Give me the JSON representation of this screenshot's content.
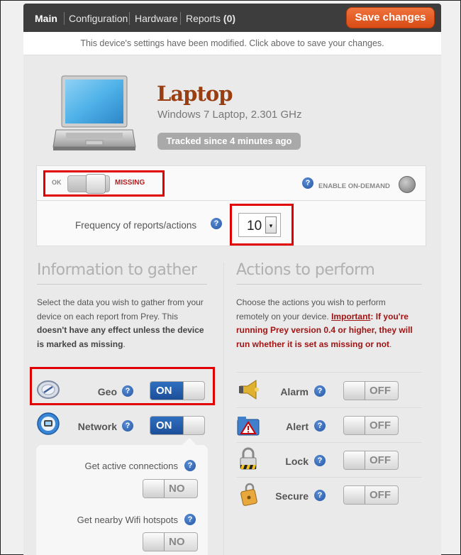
{
  "nav": {
    "tabs": [
      {
        "label": "Main"
      },
      {
        "label": "Configuration"
      },
      {
        "label": "Hardware"
      },
      {
        "label": "Reports"
      }
    ],
    "reports_count": "(0)",
    "save_label": "Save changes"
  },
  "notice": "This device's settings have been modified. Click above to save your changes.",
  "device": {
    "name": "Laptop",
    "subtitle": "Windows 7 Laptop, 2.301 GHz",
    "tracked": "Tracked since 4 minutes ago"
  },
  "status": {
    "ok_label": "OK",
    "missing_label": "MISSING",
    "ondemand_label": "ENABLE ON-DEMAND",
    "frequency_label": "Frequency of reports/actions",
    "frequency_value": "10"
  },
  "info": {
    "title": "Information to gather",
    "text_1": "Select the data you wish to gather from your",
    "text_2": "device on each report from Prey. This",
    "text_3": "doesn't have any effect unless the device",
    "text_4": "is marked as missing",
    "text_4_end": ".",
    "items": [
      {
        "label": "Geo",
        "state": "ON"
      },
      {
        "label": "Network",
        "state": "ON"
      }
    ],
    "sub_items": [
      {
        "label": "Get active connections",
        "state": "NO"
      },
      {
        "label": "Get nearby Wifi hotspots",
        "state": "NO"
      }
    ]
  },
  "actions": {
    "title": "Actions to perform",
    "text_1": "Choose the actions you wish to perform",
    "text_2a": "remotely on your device. ",
    "text_2b": "Important",
    "text_2c": ": If you're",
    "text_3": "running Prey version 0.4 or higher, they will",
    "text_4a": "run whether it is set as missing or not",
    "text_4b": ".",
    "items": [
      {
        "label": "Alarm",
        "state": "OFF"
      },
      {
        "label": "Alert",
        "state": "OFF"
      },
      {
        "label": "Lock",
        "state": "OFF"
      },
      {
        "label": "Secure",
        "state": "OFF"
      }
    ]
  },
  "help_glyph": "?",
  "select_arrow": "▾",
  "colors": {
    "nav_bg": "#3d3d3d",
    "save_orange": "#e0561c",
    "device_name": "#9a3e12",
    "toggle_on": "#2360b0",
    "highlight_red": "#e00000",
    "warning_red": "#a01414"
  }
}
